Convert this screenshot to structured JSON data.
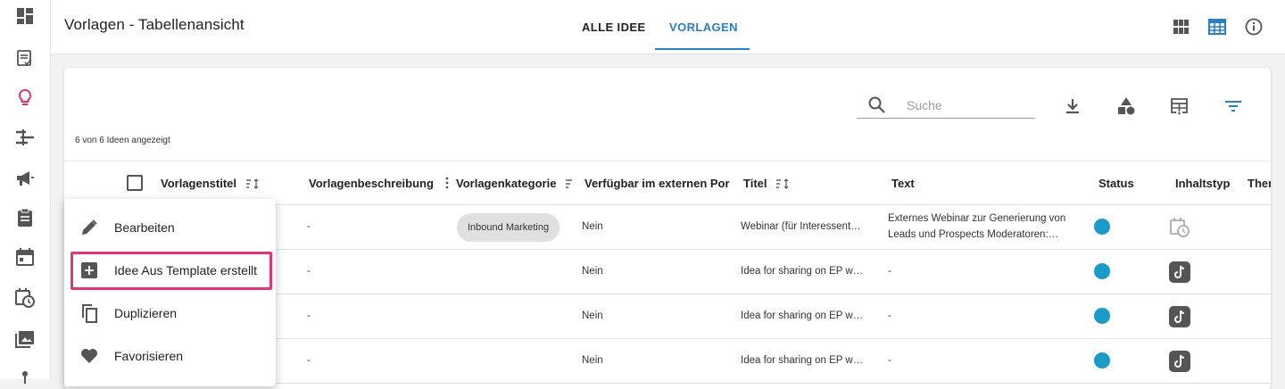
{
  "app": {
    "page_title": "Vorlagen - Tabellenansicht",
    "tabs": [
      {
        "label": "ALLE IDEE",
        "active": false
      },
      {
        "label": "VORLAGEN",
        "active": true
      }
    ],
    "accent_color": "#2a7fc4",
    "highlight_color": "#e0357a"
  },
  "sidebar": {
    "items": [
      {
        "icon": "dashboard-icon"
      },
      {
        "icon": "task-list-icon"
      },
      {
        "icon": "lightbulb-icon",
        "active": true,
        "color": "#d6336c"
      },
      {
        "icon": "timeline-icon"
      },
      {
        "icon": "megaphone-icon"
      },
      {
        "icon": "clipboard-icon"
      },
      {
        "icon": "calendar-icon"
      },
      {
        "icon": "calendar-clock-icon"
      },
      {
        "icon": "photo-library-icon"
      },
      {
        "icon": "pin-icon"
      }
    ]
  },
  "top_actions": [
    {
      "icon": "grid-view-icon"
    },
    {
      "icon": "table-view-icon",
      "active": true
    },
    {
      "icon": "info-icon"
    }
  ],
  "toolbar": {
    "search_placeholder": "Suche",
    "search_value": "",
    "icons": [
      "download-icon",
      "shapes-icon",
      "table-columns-icon",
      "filter-icon"
    ]
  },
  "table": {
    "count_text": "6 von 6 Ideen angezeigt",
    "columns": [
      {
        "label": "Vorlagenstitel",
        "sortable": true
      },
      {
        "label": "Vorlagenbeschreibung",
        "menu": true
      },
      {
        "label": "Vorlagenkategorie",
        "sortable": true
      },
      {
        "label": "Verfügbar im externen Por",
        "sortable": false
      },
      {
        "label": "Titel",
        "sortable": true
      },
      {
        "label": "Text",
        "sortable": false
      },
      {
        "label": "Status",
        "sortable": false
      },
      {
        "label": "Inhaltstyp",
        "sortable": false
      },
      {
        "label": "Ther",
        "sortable": false
      }
    ],
    "rows": [
      {
        "description": "-",
        "category": "Inbound Marketing",
        "external": "Nein",
        "title": "Webinar (für Interessent…",
        "text_line1": "Externes Webinar zur Generierung von",
        "text_line2": "Leads und Prospects  Moderatoren:…",
        "status_color": "#1a9bc8",
        "content_type_icon": "calendar-clock-icon"
      },
      {
        "description": "-",
        "category": "",
        "external": "Nein",
        "title": "Idea for sharing on EP w…",
        "text_line1": "-",
        "text_line2": "",
        "status_color": "#1a9bc8",
        "content_type_icon": "tiktok-icon"
      },
      {
        "description": "-",
        "category": "",
        "external": "Nein",
        "title": "Idea for sharing on EP w…",
        "text_line1": "-",
        "text_line2": "",
        "status_color": "#1a9bc8",
        "content_type_icon": "tiktok-icon"
      },
      {
        "description": "-",
        "category": "",
        "external": "Nein",
        "title": "Idea for sharing on EP w…",
        "text_line1": "-",
        "text_line2": "",
        "status_color": "#1a9bc8",
        "content_type_icon": "tiktok-icon"
      }
    ]
  },
  "context_menu": {
    "items": [
      {
        "label": "Bearbeiten",
        "icon": "pencil-icon"
      },
      {
        "label": "Idee Aus Template erstellt",
        "icon": "add-box-icon",
        "highlighted": true
      },
      {
        "label": "Duplizieren",
        "icon": "copy-icon"
      },
      {
        "label": "Favorisieren",
        "icon": "heart-icon"
      }
    ]
  }
}
